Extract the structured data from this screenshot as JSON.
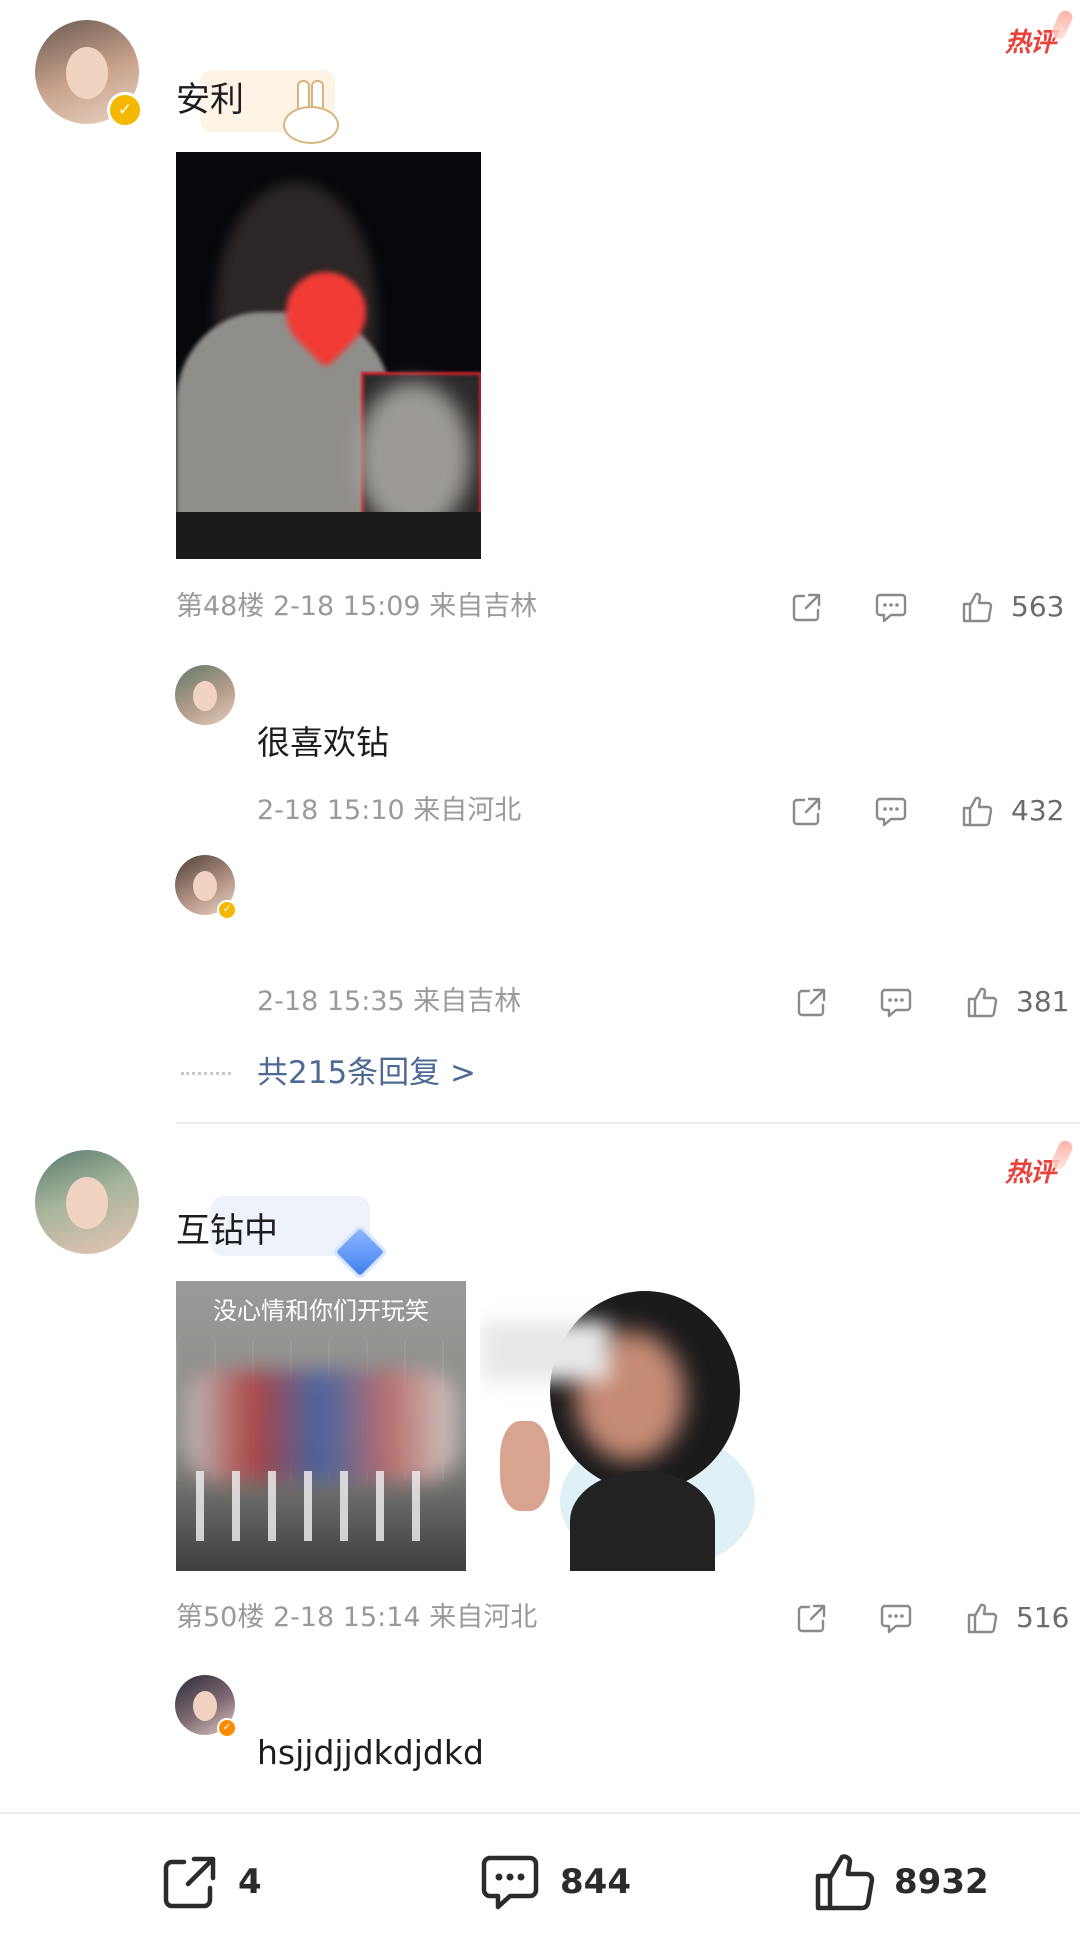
{
  "comments": [
    {
      "text": "安利",
      "hot_tag": "热评",
      "meta": "第48楼 2-18 15:09 来自吉林",
      "likes": "563",
      "replies": [
        {
          "text": "很喜欢钻",
          "meta": "2-18 15:10 来自河北",
          "likes": "432"
        },
        {
          "text": "",
          "meta": "2-18 15:35 来自吉林",
          "likes": "381"
        }
      ],
      "more_replies": "共215条回复 >"
    },
    {
      "text": "互钻中",
      "hot_tag": "热评",
      "image_caption": "没心情和你们开玩笑",
      "meta": "第50楼 2-18 15:14 来自河北",
      "likes": "516",
      "replies": [
        {
          "text": "hsjjdjjdkdjdkd"
        }
      ]
    }
  ],
  "bottom_bar": {
    "share_count": "4",
    "comment_count": "844",
    "like_count": "8932"
  },
  "icons": {
    "share": "share-icon",
    "comment": "comment-icon",
    "like": "thumbs-up-icon",
    "verified": "verified-badge-icon"
  },
  "colors": {
    "hot_tag": "#e8423b",
    "link": "#4d6a94",
    "meta": "#9a9a9a"
  }
}
